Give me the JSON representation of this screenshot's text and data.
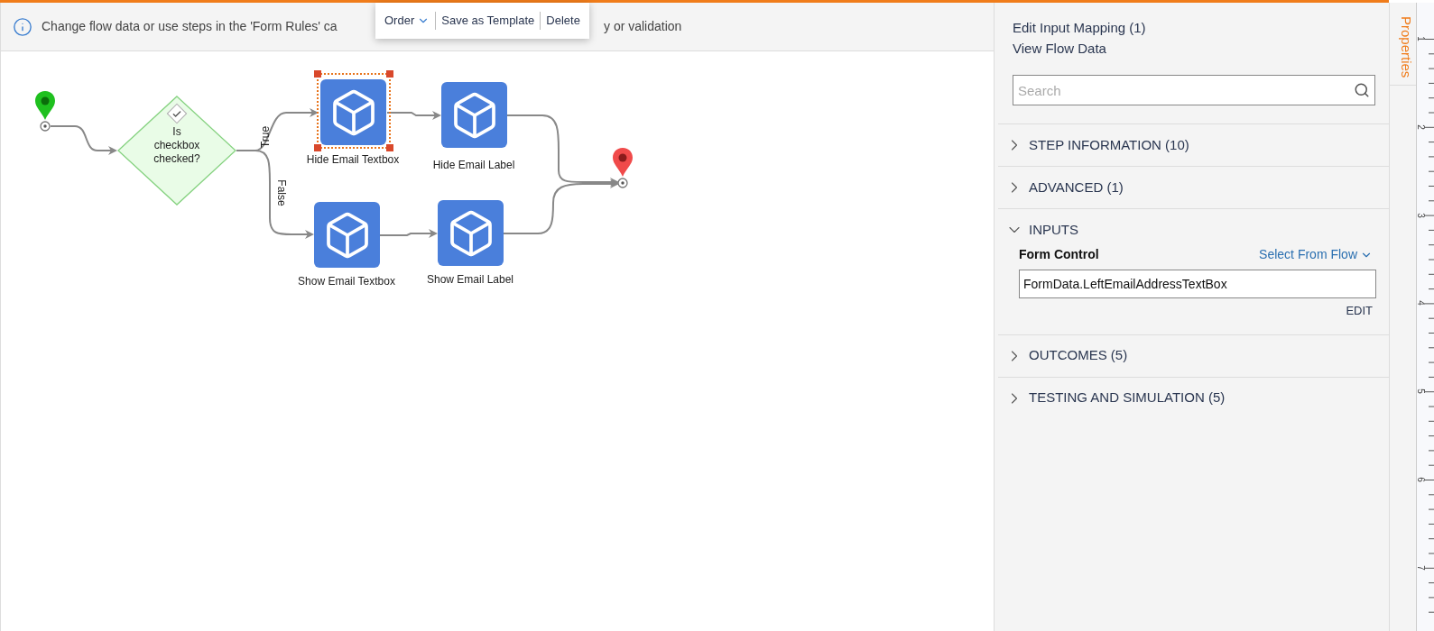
{
  "banner": {
    "text_before": "Change flow data or use steps in the 'Form Rules' ca",
    "text_after": "y or validation"
  },
  "toolbar": {
    "items": [
      {
        "label": "Order",
        "kind": "dropdown"
      },
      {
        "label": "Save as Template",
        "kind": "action"
      },
      {
        "label": "Delete",
        "kind": "action"
      }
    ]
  },
  "flow": {
    "nodes": [
      {
        "kind": "start"
      },
      {
        "kind": "decision",
        "label": "Is checkbox checked?"
      },
      {
        "kind": "step",
        "label": "Hide Email Textbox",
        "selected": true
      },
      {
        "kind": "step",
        "label": "Hide Email Label",
        "selected": false
      },
      {
        "kind": "step",
        "label": "Show Email Textbox",
        "selected": false
      },
      {
        "kind": "step",
        "label": "Show Email Label",
        "selected": false
      },
      {
        "kind": "end"
      }
    ],
    "connectors": [
      {
        "label": "True"
      },
      {
        "label": "False"
      }
    ]
  },
  "panel": {
    "links": [
      "Edit Input Mapping (1)",
      "View Flow Data"
    ],
    "search": {
      "placeholder": "Search"
    },
    "sections": [
      {
        "title": "STEP INFORMATION (10)",
        "expanded": false
      },
      {
        "title": "ADVANCED (1)",
        "expanded": false
      },
      {
        "title": "INPUTS",
        "expanded": true,
        "fields": [
          {
            "label": "Form Control",
            "source": "Select From Flow",
            "value": "FormData.LeftEmailAddressTextBox",
            "action": "EDIT"
          }
        ]
      },
      {
        "title": "OUTCOMES (5)",
        "expanded": false
      },
      {
        "title": "TESTING AND SIMULATION (5)",
        "expanded": false
      }
    ]
  },
  "side_tab": {
    "label": "Properties",
    "selected": true
  },
  "ruler": {
    "labels": [
      "1",
      "2",
      "3",
      "4",
      "5",
      "6",
      "7"
    ]
  }
}
